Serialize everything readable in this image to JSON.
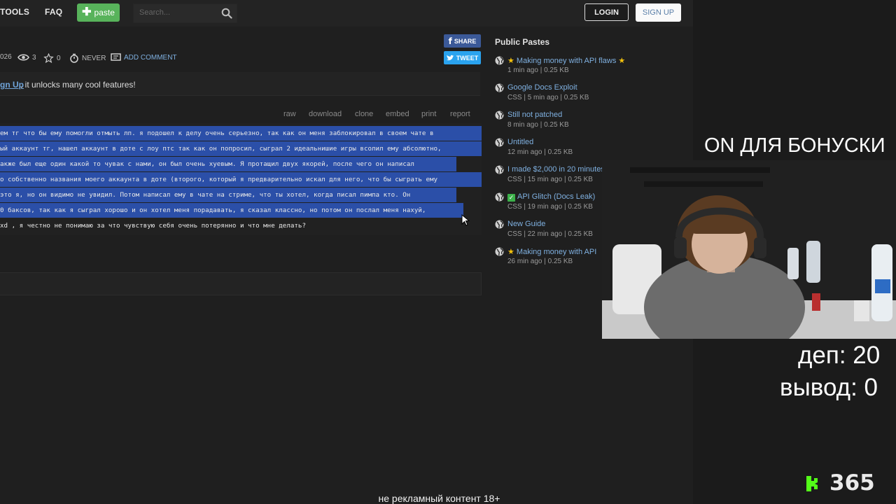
{
  "nav": {
    "tools": "TOOLS",
    "faq": "FAQ",
    "paste_label": "paste",
    "search_placeholder": "Search...",
    "login": "LOGIN",
    "signup": "SIGN UP"
  },
  "paste_meta": {
    "date_fragment": "026",
    "views": "3",
    "stars": "0",
    "expire": "NEVER",
    "add_comment": "ADD COMMENT",
    "share": "SHARE",
    "tweet": "TWEET"
  },
  "notice": {
    "link": "gn Up",
    "rest": ", it unlocks many cool features!"
  },
  "toolbar": [
    "raw",
    "download",
    "clone",
    "embed",
    "print",
    "report"
  ],
  "code_lines": [
    "ем тг что бы ему помогли отмыть лп. я подошел к делу очень серьезно, так как он меня заблокировал в своем чате в",
    "ый аккаунт тг, нашел аккаунт в доте с лоу птс так как он попросил, сыграл 2 идеальнишие игры всолил ему абсолютно,",
    "акже был еще один какой то чувак с нами, он был очень хуевым. Я протащил двух якорей, после чего он написал",
    "о собственно названия моего аккаунта в доте (второго, который я предварительно искал для него, что бы сыграть ему",
    "это я, но он видимо не увидил. Потом написал ему в чате на стриме, что ты хотел, когда писал пимпа кто. Он",
    "0 баксов, так как я сыграл хорошо и он хотел меня порадавать, я сказал классно, но потом он послал меня нахуй,",
    "xd , я честно не понимаю за что чувствую себя очень потерянно и что мне делать?"
  ],
  "sidebar": {
    "title": "Public Pastes",
    "items": [
      {
        "title": "Making money with API flaws",
        "meta": "1 min ago | 0.25 KB",
        "star": true,
        "check": false
      },
      {
        "title": "Google Docs Exploit",
        "meta": "CSS | 5 min ago | 0.25 KB",
        "star": false,
        "check": false
      },
      {
        "title": "Still not patched",
        "meta": "8 min ago | 0.25 KB",
        "star": false,
        "check": false
      },
      {
        "title": "Untitled",
        "meta": "12 min ago | 0.25 KB",
        "star": false,
        "check": false
      },
      {
        "title": "I made $2,000 in 20 minutes",
        "meta": "CSS | 15 min ago | 0.25 KB",
        "star": false,
        "check": false
      },
      {
        "title": "API Glitch (Docs Leak)",
        "meta": "CSS | 19 min ago | 0.25 KB",
        "star": false,
        "check": true
      },
      {
        "title": "New Guide",
        "meta": "CSS | 22 min ago | 0.25 KB",
        "star": false,
        "check": false
      },
      {
        "title": "Making money with API",
        "meta": "26 min ago | 0.25 KB",
        "star": true,
        "check": false
      }
    ]
  },
  "overlay": {
    "banner": "ON ДЛЯ БОНУСКИ",
    "dep": "деп: 20",
    "vyvod": "вывод: 0",
    "counter": "365",
    "caption": "не рекламный контент 18+"
  },
  "colors": {
    "paste_green": "#58b35b",
    "link_blue": "#7fb0e0",
    "selection_blue": "#2b4fa8",
    "facebook": "#3b5998",
    "twitter": "#2aa3ef",
    "star": "#f4c20d",
    "kick_green": "#53fc18"
  }
}
